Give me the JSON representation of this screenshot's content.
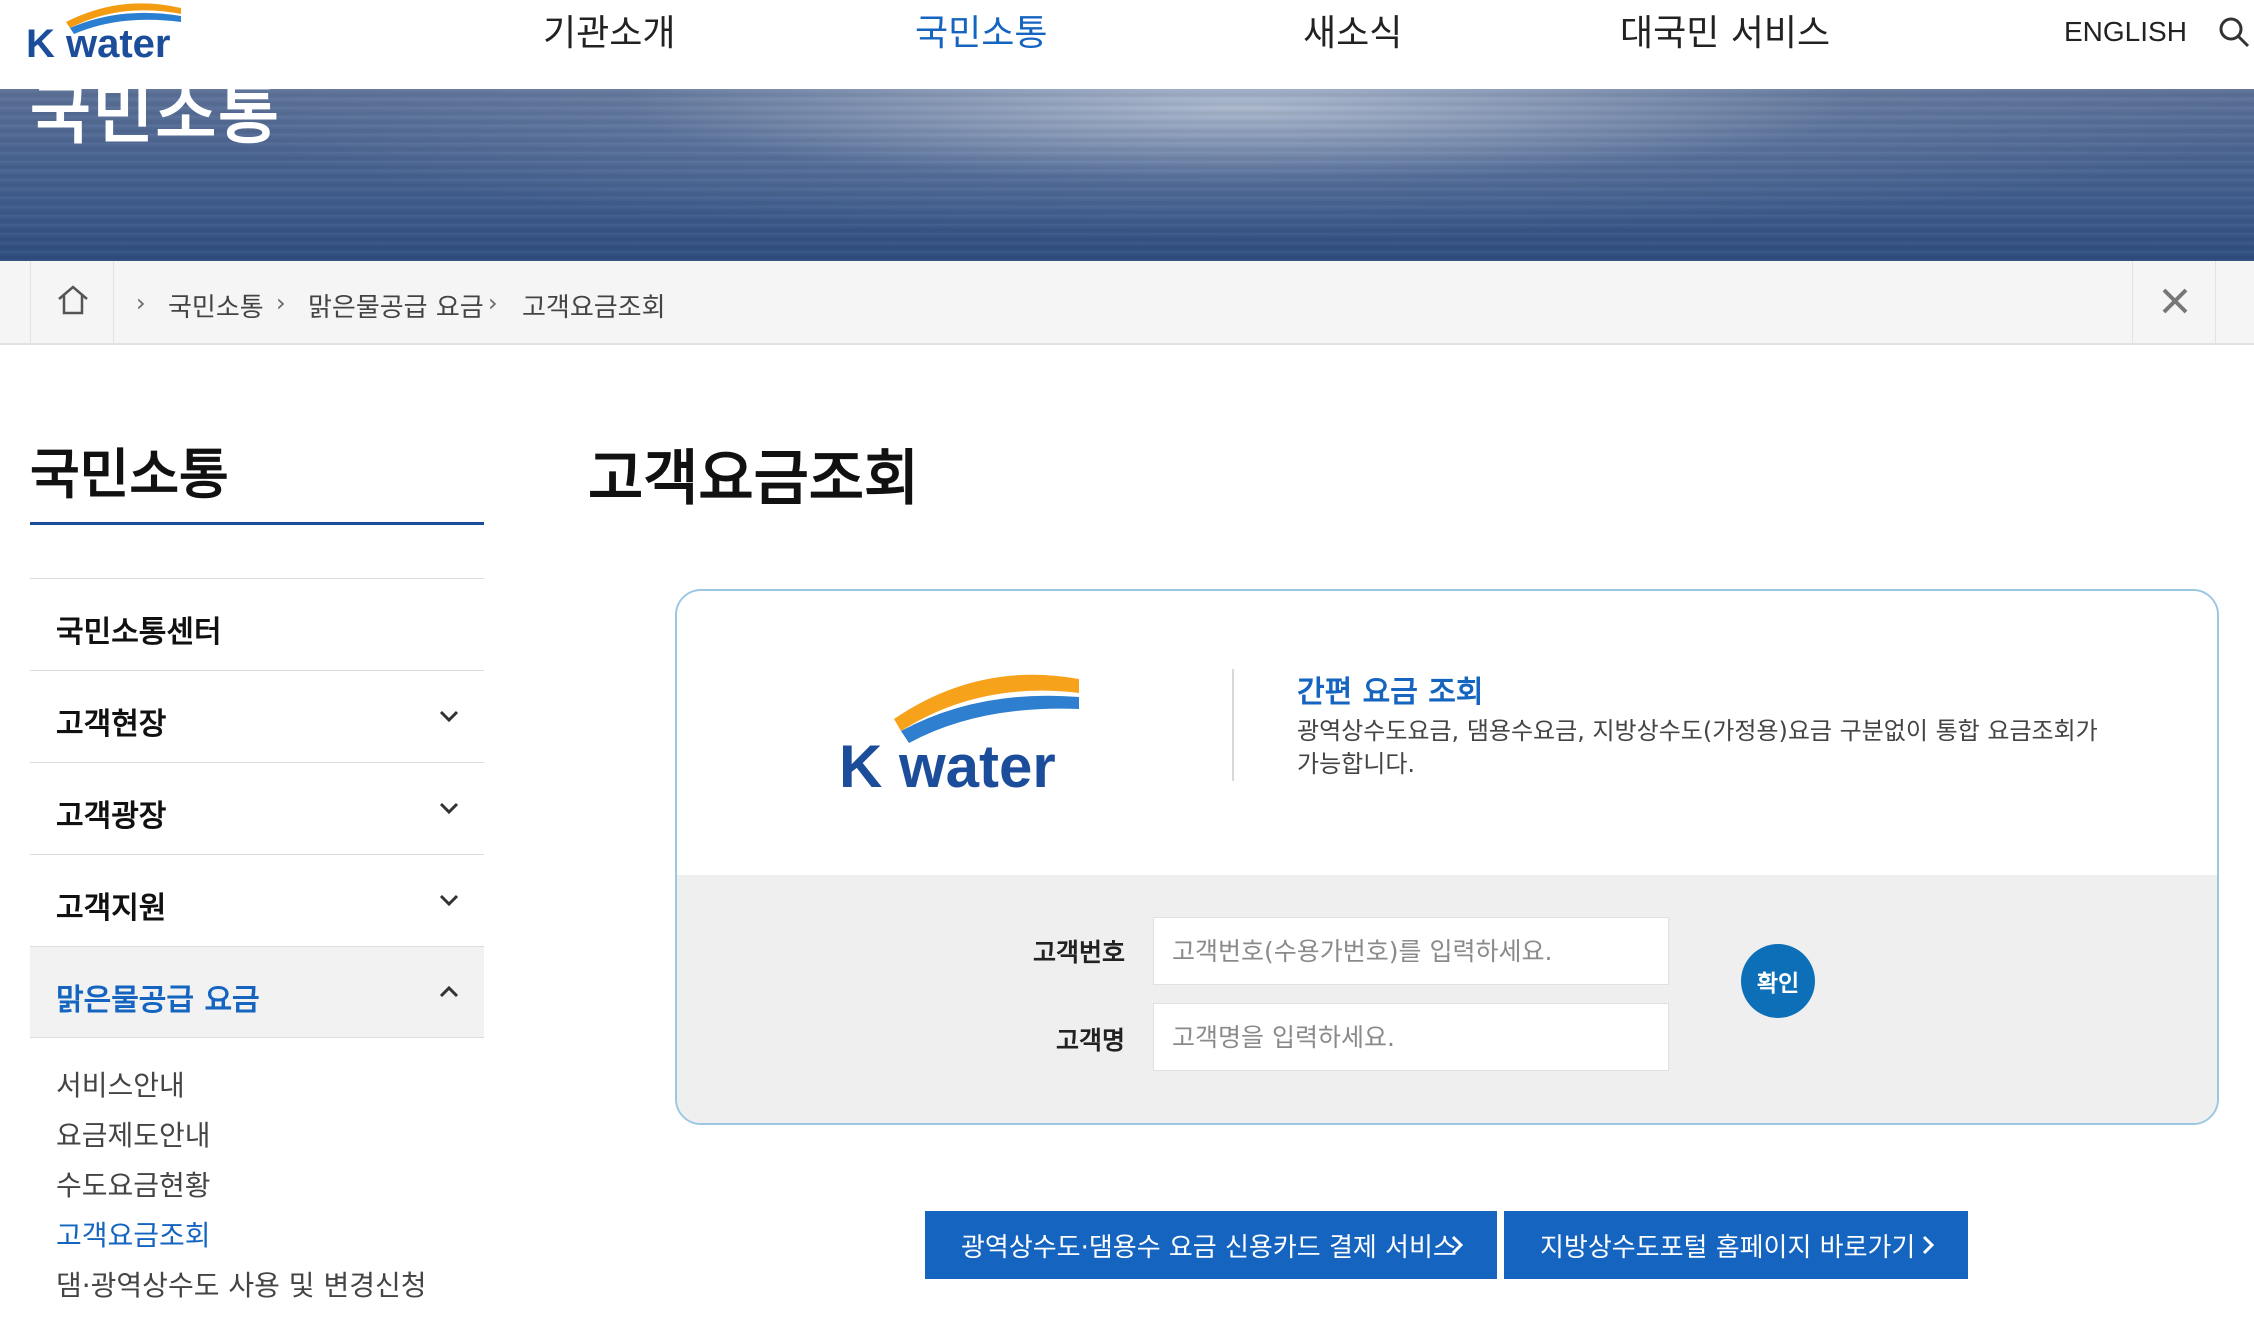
{
  "header": {
    "logo_text": "K water",
    "nav": [
      {
        "label": "기관소개"
      },
      {
        "label": "국민소통"
      },
      {
        "label": "새소식"
      },
      {
        "label": "대국민 서비스"
      }
    ],
    "english_label": "ENGLISH",
    "accent_color": "#1565c0"
  },
  "banner": {
    "title": "국민소통"
  },
  "breadcrumb": {
    "items": [
      "국민소통",
      "맑은물공급 요금",
      "고객요금조회"
    ]
  },
  "sidebar": {
    "title": "국민소통",
    "items": [
      {
        "label": "국민소통센터"
      },
      {
        "label": "고객현장"
      },
      {
        "label": "고객광장"
      },
      {
        "label": "고객지원"
      },
      {
        "label": "맑은물공급 요금"
      }
    ],
    "sub_items": [
      {
        "label": "서비스안내"
      },
      {
        "label": "요금제도안내"
      },
      {
        "label": "수도요금현황"
      },
      {
        "label": "고객요금조회"
      },
      {
        "label": "댐·광역상수도 사용 및 변경신청"
      }
    ]
  },
  "main": {
    "title": "고객요금조회",
    "box": {
      "logo_text": "K water",
      "subtitle": "간편 요금 조회",
      "description": "광역상수도요금, 댐용수요금, 지방상수도(가정용)요금 구분없이 통합 요금조회가 가능합니다.",
      "customer_no_label": "고객번호",
      "customer_no_placeholder": "고객번호(수용가번호)를 입력하세요.",
      "customer_name_label": "고객명",
      "customer_name_placeholder": "고객명을 입력하세요.",
      "confirm_label": "확인"
    },
    "links": [
      {
        "label": "광역상수도·댐용수 요금 신용카드 결제 서비스"
      },
      {
        "label": "지방상수도포털 홈페이지 바로가기"
      }
    ]
  }
}
